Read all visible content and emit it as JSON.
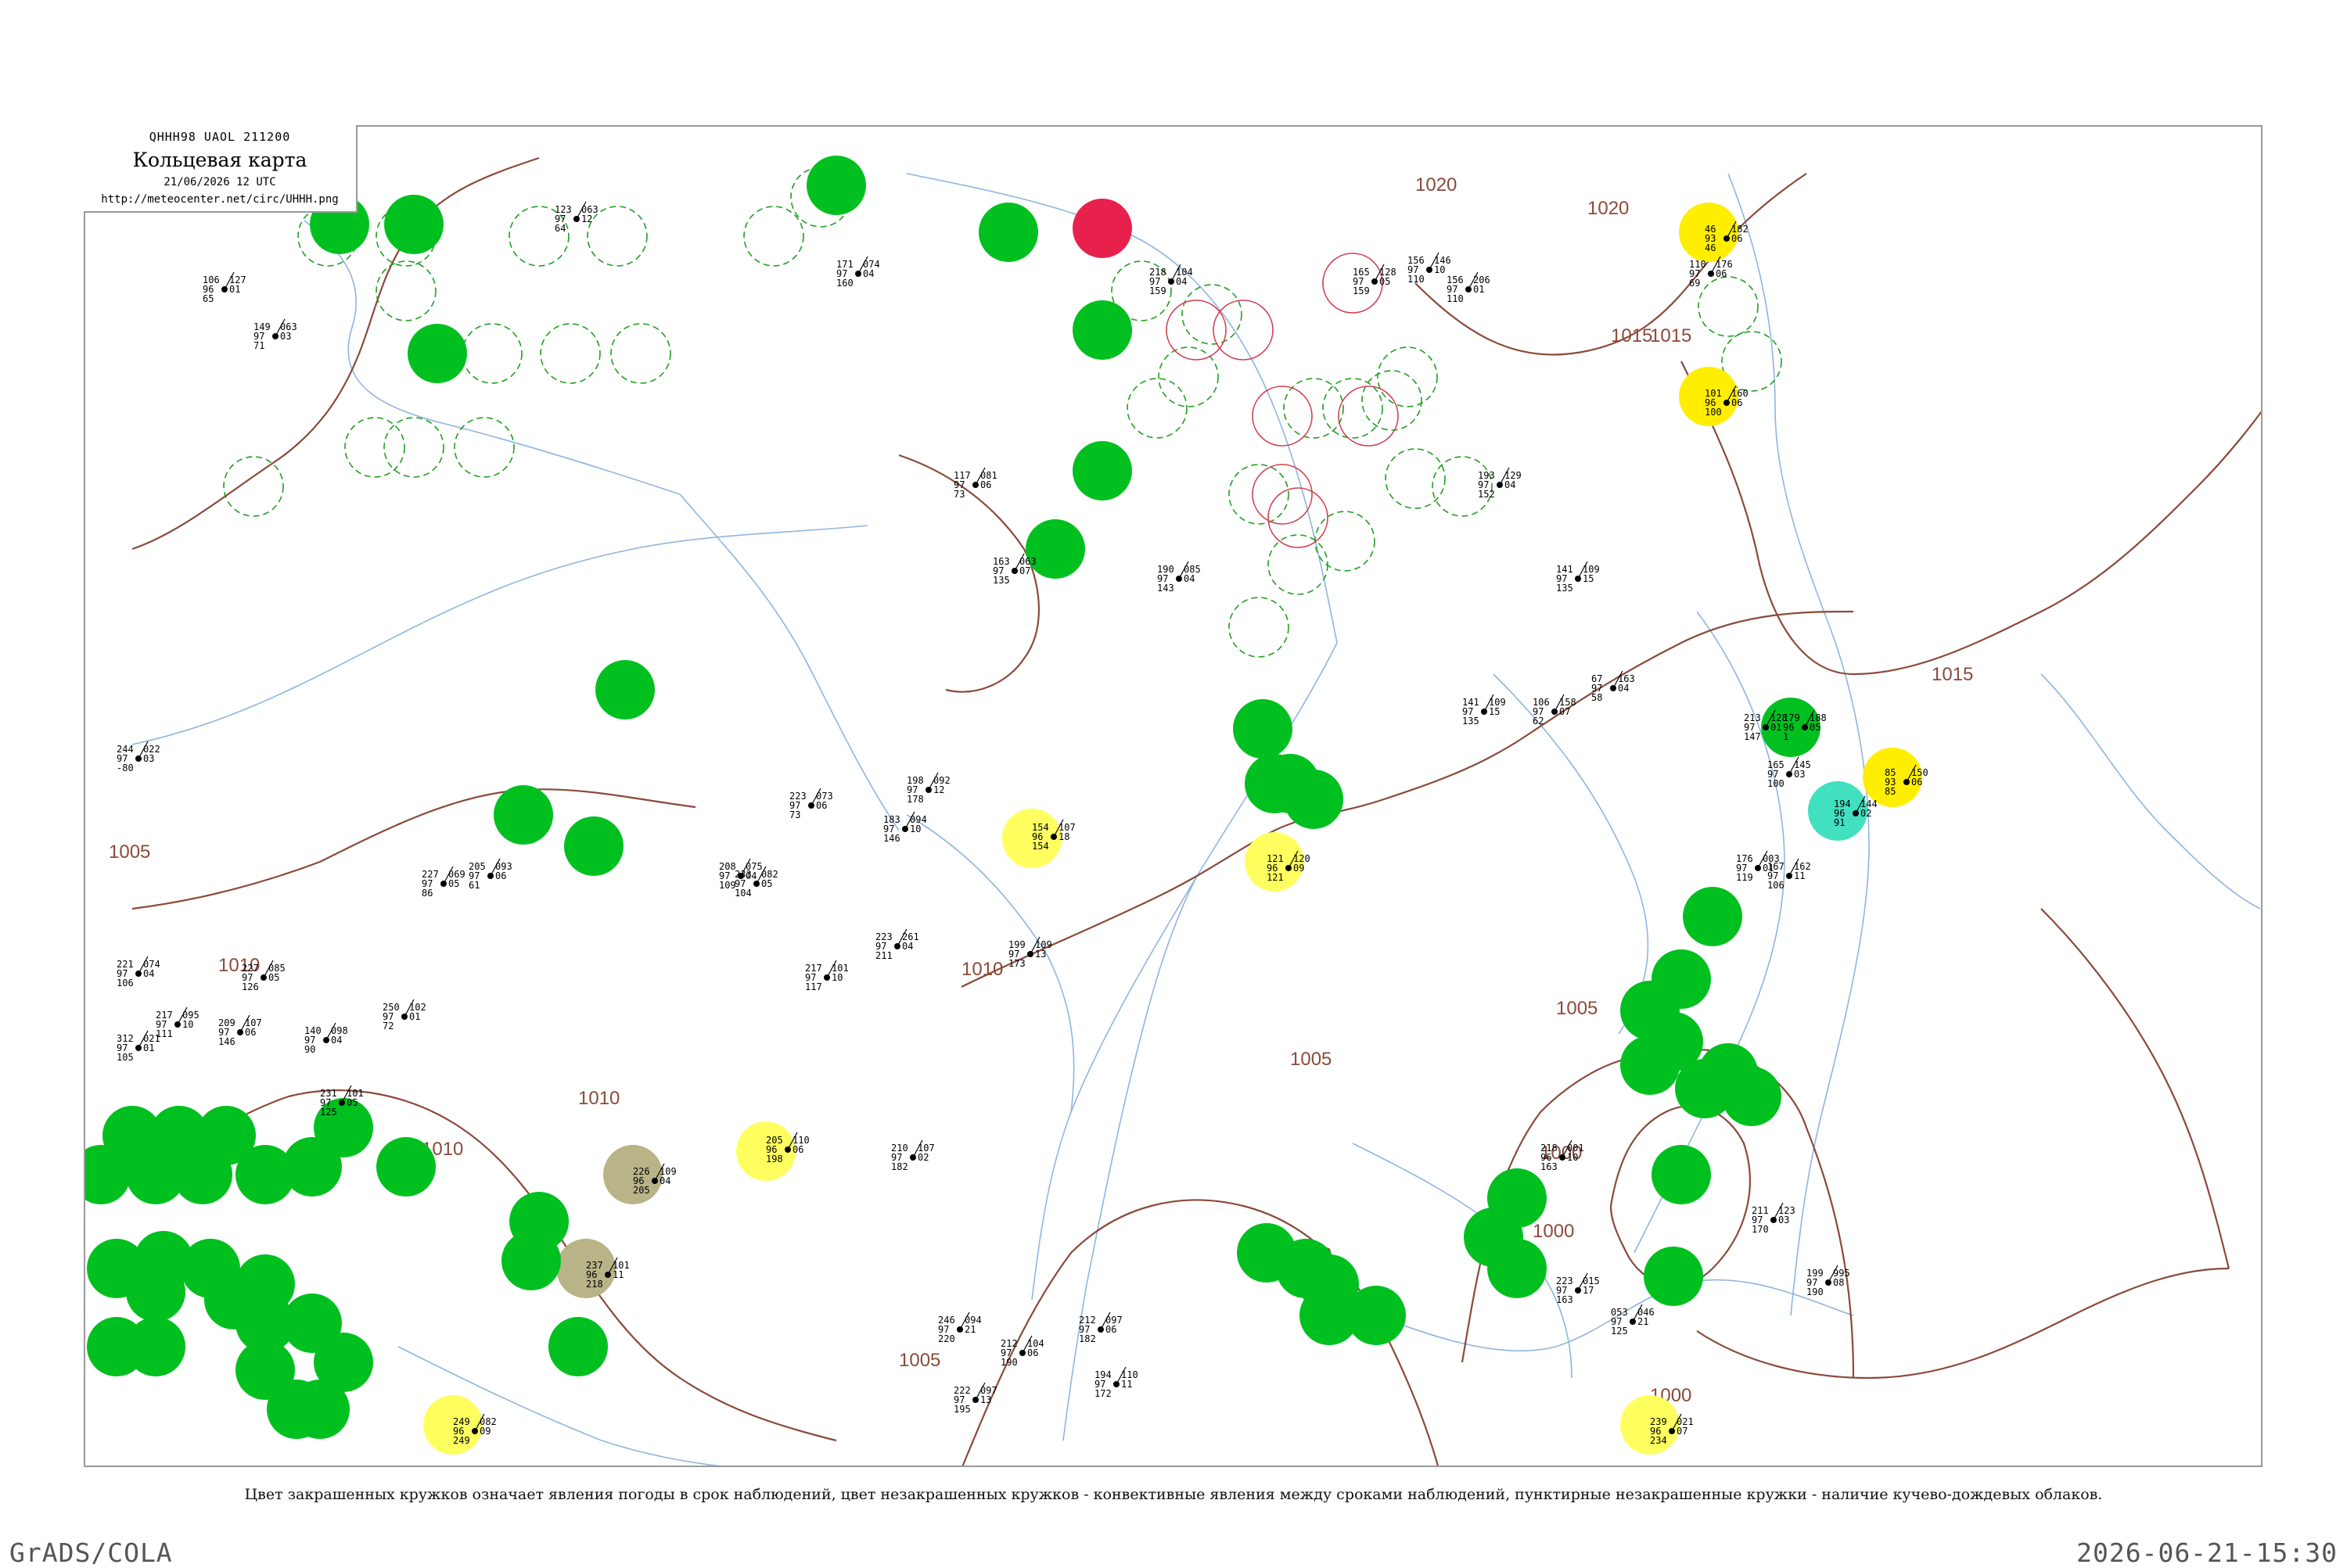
{
  "header": {
    "code": "QHHH98  UAOL  211200",
    "title": "Кольцевая карта",
    "date": "21/06/2026 12 UTC",
    "url": "http://meteocenter.net/circ/UHHH.png"
  },
  "isobar_labels": [
    "1020",
    "1020",
    "1015",
    "1015",
    "1015",
    "1010",
    "1010",
    "1010",
    "1010",
    "1010",
    "1005",
    "1005",
    "1005",
    "1005",
    "1000",
    "1000",
    "1000"
  ],
  "legend_note": "Цвет закрашенных кружков означает явления погоды в срок наблюдений, цвет незакрашенных кружков - конвективные явления между сроками наблюдений, пунктирные незакрашенные кружки - наличие кучево-дождевых облаков.",
  "footer": {
    "left": "GrADS/COLA",
    "right": "2026-06-21-15:30"
  },
  "colors": {
    "isobar": "#8a4a3a",
    "river": "#8fb5e0",
    "rain": "#00c020",
    "showers_light": "#ffff60",
    "heavy": "#ffee00",
    "thunder": "#e8204c",
    "fog": "#b8b488",
    "drizzle": "#40e0c0",
    "cb_dashed": "#20a020",
    "convective_ring": "#d04050"
  },
  "stations": [
    {
      "a": "123",
      "b": "97",
      "c": "64",
      "d": "063",
      "e": "12"
    },
    {
      "a": "106",
      "b": "96",
      "c": "65",
      "d": "127",
      "e": "01"
    },
    {
      "a": "149",
      "b": "97",
      "c": "71",
      "d": "063",
      "e": "03"
    },
    {
      "a": "171",
      "b": "97",
      "c": "160",
      "d": "074",
      "e": "04"
    },
    {
      "a": "218",
      "b": "97",
      "c": "159",
      "d": "104",
      "e": "04"
    },
    {
      "a": "165",
      "b": "97",
      "c": "159",
      "d": "128",
      "e": "05"
    },
    {
      "a": "156",
      "b": "97",
      "c": "110",
      "d": "206",
      "e": "01"
    },
    {
      "a": "110",
      "b": "97",
      "c": "69",
      "d": "176",
      "e": "06"
    },
    {
      "a": "141",
      "b": "97",
      "c": "135",
      "d": "109",
      "e": "15"
    },
    {
      "a": "205",
      "b": "96",
      "c": "198",
      "d": "110",
      "e": "06"
    },
    {
      "a": "226",
      "b": "96",
      "c": "205",
      "d": "109",
      "e": "04"
    },
    {
      "a": "237",
      "b": "96",
      "c": "218",
      "d": "101",
      "e": "11"
    },
    {
      "a": "249",
      "b": "96",
      "c": "249",
      "d": "082",
      "e": "09"
    },
    {
      "a": "239",
      "b": "96",
      "c": "234",
      "d": "021",
      "e": "07"
    },
    {
      "a": "154",
      "b": "96",
      "c": "154",
      "d": "107",
      "e": "18"
    },
    {
      "a": "121",
      "b": "96",
      "c": "121",
      "d": "120",
      "e": "09"
    },
    {
      "a": "46",
      "b": "93",
      "c": "46",
      "d": "182",
      "e": "06"
    },
    {
      "a": "101",
      "b": "96",
      "c": "100",
      "d": "160",
      "e": "06"
    },
    {
      "a": "85",
      "b": "93",
      "c": "85",
      "d": "150",
      "e": "06"
    },
    {
      "a": "194",
      "b": "96",
      "c": "91",
      "d": "144",
      "e": "02"
    },
    {
      "a": "179",
      "b": "96",
      "c": "1",
      "d": "188",
      "e": "05"
    },
    {
      "a": "244",
      "b": "97",
      "c": "-80",
      "d": "022",
      "e": "03"
    },
    {
      "a": "221",
      "b": "97",
      "c": "106",
      "d": "074",
      "e": "04"
    },
    {
      "a": "312",
      "b": "97",
      "c": "105",
      "d": "021",
      "e": "01"
    },
    {
      "a": "217",
      "b": "97",
      "c": "111",
      "d": "095",
      "e": "10"
    },
    {
      "a": "209",
      "b": "97",
      "c": "146",
      "d": "107",
      "e": "06"
    },
    {
      "a": "227",
      "b": "97",
      "c": "126",
      "d": "085",
      "e": "05"
    },
    {
      "a": "140",
      "b": "97",
      "c": "90",
      "d": "098",
      "e": "04"
    },
    {
      "a": "231",
      "b": "97",
      "c": "125",
      "d": "101",
      "e": "05"
    },
    {
      "a": "250",
      "b": "97",
      "c": "72",
      "d": "102",
      "e": "01"
    },
    {
      "a": "227",
      "b": "97",
      "c": "86",
      "d": "069",
      "e": "05"
    },
    {
      "a": "205",
      "b": "97",
      "c": "61",
      "d": "093",
      "e": "06"
    },
    {
      "a": "208",
      "b": "97",
      "c": "109",
      "d": "075",
      "e": "04"
    },
    {
      "a": "223",
      "b": "97",
      "c": "73",
      "d": "073",
      "e": "06"
    },
    {
      "a": "198",
      "b": "97",
      "c": "178",
      "d": "092",
      "e": "12"
    },
    {
      "a": "183",
      "b": "97",
      "c": "146",
      "d": "094",
      "e": "10"
    },
    {
      "a": "233",
      "b": "97",
      "c": "104",
      "d": "082",
      "e": "05"
    },
    {
      "a": "217",
      "b": "97",
      "c": "117",
      "d": "101",
      "e": "10"
    },
    {
      "a": "223",
      "b": "97",
      "c": "211",
      "d": "261",
      "e": "04"
    },
    {
      "a": "199",
      "b": "97",
      "c": "173",
      "d": "109",
      "e": "13"
    },
    {
      "a": "210",
      "b": "97",
      "c": "182",
      "d": "107",
      "e": "02"
    },
    {
      "a": "246",
      "b": "97",
      "c": "220",
      "d": "094",
      "e": "21"
    },
    {
      "a": "222",
      "b": "97",
      "c": "195",
      "d": "097",
      "e": "13"
    },
    {
      "a": "212",
      "b": "97",
      "c": "190",
      "d": "104",
      "e": "06"
    },
    {
      "a": "194",
      "b": "97",
      "c": "172",
      "d": "110",
      "e": "11"
    },
    {
      "a": "212",
      "b": "97",
      "c": "182",
      "d": "097",
      "e": "06"
    },
    {
      "a": "218",
      "b": "96",
      "c": "163",
      "d": "001",
      "e": "10"
    },
    {
      "a": "176",
      "b": "97",
      "c": "119",
      "d": "003",
      "e": "01"
    },
    {
      "a": "213",
      "b": "97",
      "c": "147",
      "d": "128",
      "e": "01"
    },
    {
      "a": "165",
      "b": "97",
      "c": "100",
      "d": "145",
      "e": "03"
    },
    {
      "a": "167",
      "b": "97",
      "c": "106",
      "d": "162",
      "e": "11"
    },
    {
      "a": "211",
      "b": "97",
      "c": "170",
      "d": "123",
      "e": "03"
    },
    {
      "a": "199",
      "b": "97",
      "c": "190",
      "d": "995",
      "e": "08"
    },
    {
      "a": "223",
      "b": "97",
      "c": "163",
      "d": "015",
      "e": "17"
    },
    {
      "a": "053",
      "b": "97",
      "c": "125",
      "d": "046",
      "e": "21"
    },
    {
      "a": "156",
      "b": "97",
      "c": "110",
      "d": "146",
      "e": "10"
    },
    {
      "a": "193",
      "b": "97",
      "c": "152",
      "d": "129",
      "e": "04"
    },
    {
      "a": "141",
      "b": "97",
      "c": "135",
      "d": "109",
      "e": "15"
    },
    {
      "a": "106",
      "b": "97",
      "c": "62",
      "d": "158",
      "e": "07"
    },
    {
      "a": "67",
      "b": "97",
      "c": "58",
      "d": "163",
      "e": "04"
    },
    {
      "a": "190",
      "b": "97",
      "c": "143",
      "d": "085",
      "e": "04"
    },
    {
      "a": "163",
      "b": "97",
      "c": "135",
      "d": "063",
      "e": "07"
    },
    {
      "a": "117",
      "b": "97",
      "c": "73",
      "d": "081",
      "e": "06"
    }
  ]
}
